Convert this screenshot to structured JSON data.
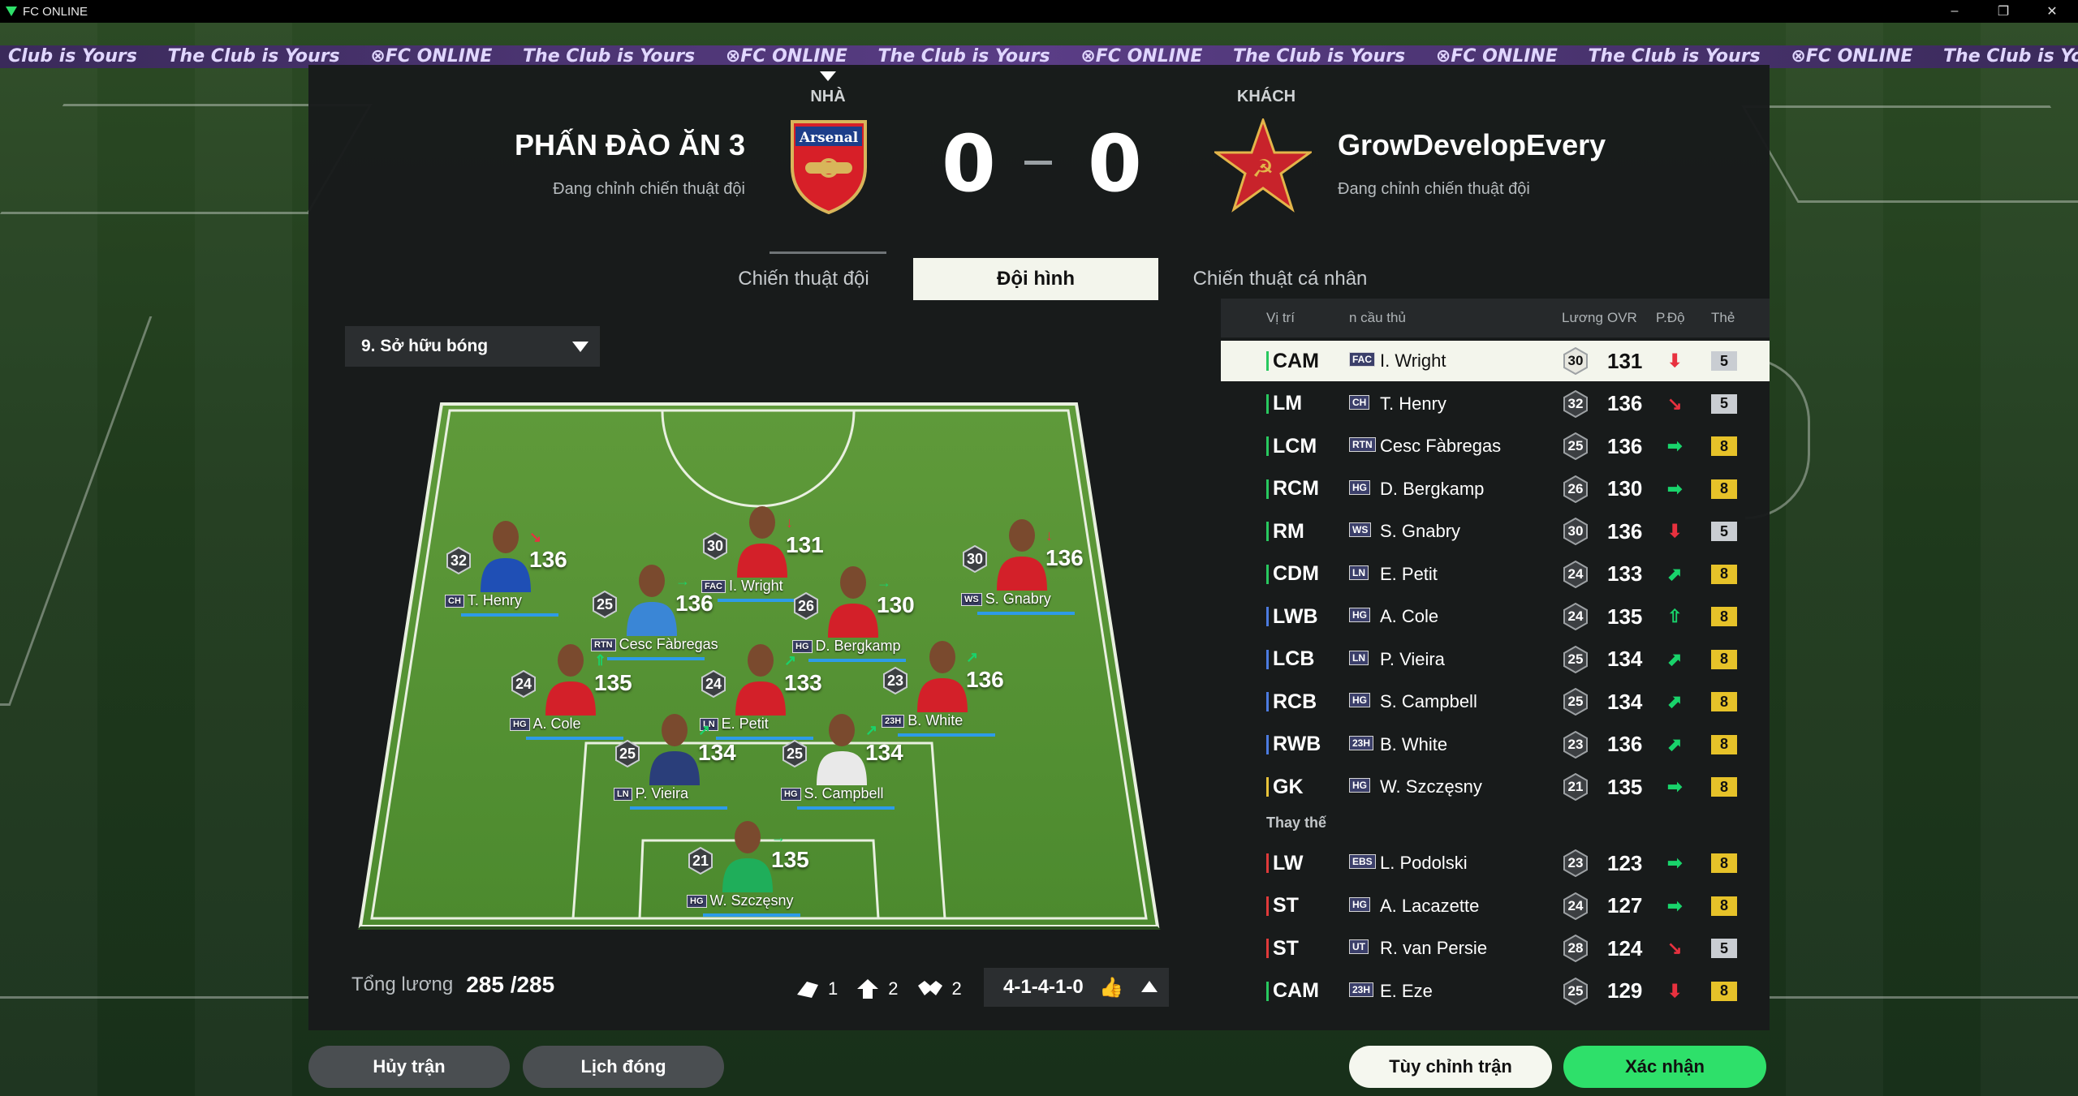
{
  "window": {
    "title": "FC ONLINE",
    "minimize": "–",
    "restore": "❐",
    "close": "✕"
  },
  "banner": {
    "items": [
      "The Club is Yours",
      "⊗FC ONLINE",
      "The Club is Yours",
      "⊗FC ONLINE",
      "The Club is Yours",
      "⊗FC ONLINE",
      "The Club is Yours",
      "⊗FC ONLINE",
      "The Club is Yours",
      "⊗FC ONLINE",
      "The Club is Yours"
    ]
  },
  "match": {
    "home_label": "NHÀ",
    "away_label": "KHÁCH",
    "home_name": "PHẤN ĐÀO ĂN 3",
    "home_status": "Đang chỉnh chiến thuật đội",
    "home_crest_text": "Arsenal",
    "away_name": "GrowDevelopEvery",
    "away_status": "Đang chỉnh chiến thuật đội",
    "home_score": "0",
    "away_score": "0"
  },
  "tabs": [
    {
      "label": "Chiến thuật đội"
    },
    {
      "label": "Đội hình"
    },
    {
      "label": "Chiến thuật cá nhân"
    }
  ],
  "tactic_dropdown": {
    "value": "9. Sở hữu bóng"
  },
  "colors": {
    "accent_green": "#2ee06a",
    "trend_up": "#19d36b",
    "trend_down": "#e8313f",
    "card_gold": "#e6c229",
    "card_silver": "#c9cdd2",
    "pos_bar_green": "#28c85f",
    "pos_bar_red": "#e03a3a",
    "pos_bar_yellow": "#e8c33a"
  },
  "pitch_players": [
    {
      "name": "T. Henry",
      "badge": "CH",
      "pay": "32",
      "ovr": "136",
      "trend": "↘",
      "trend_color": "#e8313f",
      "shirt": "#1f4fb5"
    },
    {
      "name": "I. Wright",
      "badge": "FAC",
      "pay": "30",
      "ovr": "131",
      "trend": "↓",
      "trend_color": "#e8313f",
      "shirt": "#d32029"
    },
    {
      "name": "S. Gnabry",
      "badge": "WS",
      "pay": "30",
      "ovr": "136",
      "trend": "↓",
      "trend_color": "#e8313f",
      "shirt": "#d32029"
    },
    {
      "name": "Cesc Fàbregas",
      "badge": "RTN",
      "pay": "25",
      "ovr": "136",
      "trend": "→",
      "trend_color": "#19d36b",
      "shirt": "#3a86d6"
    },
    {
      "name": "D. Bergkamp",
      "badge": "HG",
      "pay": "26",
      "ovr": "130",
      "trend": "→",
      "trend_color": "#19d36b",
      "shirt": "#d32029"
    },
    {
      "name": "E. Petit",
      "badge": "LN",
      "pay": "24",
      "ovr": "133",
      "trend": "↗",
      "trend_color": "#19d36b",
      "shirt": "#d32029"
    },
    {
      "name": "A. Cole",
      "badge": "HG",
      "pay": "24",
      "ovr": "135",
      "trend": "⇑",
      "trend_color": "#19d36b",
      "shirt": "#d32029"
    },
    {
      "name": "B. White",
      "badge": "23H",
      "pay": "23",
      "ovr": "136",
      "trend": "↗",
      "trend_color": "#19d36b",
      "shirt": "#d32029"
    },
    {
      "name": "P. Vieira",
      "badge": "LN",
      "pay": "25",
      "ovr": "134",
      "trend": "↗",
      "trend_color": "#19d36b",
      "shirt": "#2a3e7a"
    },
    {
      "name": "S. Campbell",
      "badge": "HG",
      "pay": "25",
      "ovr": "134",
      "trend": "↗",
      "trend_color": "#19d36b",
      "shirt": "#e9e9e9"
    },
    {
      "name": "W. Szczęsny",
      "badge": "HG",
      "pay": "21",
      "ovr": "135",
      "trend": "→",
      "trend_color": "#19d36b",
      "shirt": "#1fae5a"
    }
  ],
  "salary": {
    "label": "Tổng lương",
    "value": "285 /285"
  },
  "captains": {
    "c1": "1",
    "c2": "2",
    "c3": "2"
  },
  "formation": {
    "value": "4-1-4-1-0"
  },
  "table": {
    "headers": {
      "pos": "Vị trí",
      "name": "n cầu thủ",
      "pay": "Lương",
      "ovr": "OVR",
      "trend": "P.Độ",
      "card": "Thẻ"
    },
    "starters": [
      {
        "pos": "CAM",
        "badge": "FAC",
        "name": "I. Wright",
        "pay": "30",
        "ovr": "131",
        "trend": "⬇",
        "trend_color": "#e8313f",
        "card": "5",
        "card_color": "#c9cdd2",
        "bar": "#28c85f"
      },
      {
        "pos": "LM",
        "badge": "CH",
        "name": "T. Henry",
        "pay": "32",
        "ovr": "136",
        "trend": "↘",
        "trend_color": "#e8313f",
        "card": "5",
        "card_color": "#c9cdd2",
        "bar": "#28c85f"
      },
      {
        "pos": "LCM",
        "badge": "RTN",
        "name": "Cesc Fàbregas",
        "pay": "25",
        "ovr": "136",
        "trend": "➡",
        "trend_color": "#19d36b",
        "card": "8",
        "card_color": "#e6c229",
        "bar": "#28c85f"
      },
      {
        "pos": "RCM",
        "badge": "HG",
        "name": "D. Bergkamp",
        "pay": "26",
        "ovr": "130",
        "trend": "➡",
        "trend_color": "#19d36b",
        "card": "8",
        "card_color": "#e6c229",
        "bar": "#28c85f"
      },
      {
        "pos": "RM",
        "badge": "WS",
        "name": "S. Gnabry",
        "pay": "30",
        "ovr": "136",
        "trend": "⬇",
        "trend_color": "#e8313f",
        "card": "5",
        "card_color": "#c9cdd2",
        "bar": "#28c85f"
      },
      {
        "pos": "CDM",
        "badge": "LN",
        "name": "E. Petit",
        "pay": "24",
        "ovr": "133",
        "trend": "⬈",
        "trend_color": "#19d36b",
        "card": "8",
        "card_color": "#e6c229",
        "bar": "#28c85f"
      },
      {
        "pos": "LWB",
        "badge": "HG",
        "name": "A. Cole",
        "pay": "24",
        "ovr": "135",
        "trend": "⇧",
        "trend_color": "#19d36b",
        "card": "8",
        "card_color": "#e6c229",
        "bar": "#4b7be0"
      },
      {
        "pos": "LCB",
        "badge": "LN",
        "name": "P. Vieira",
        "pay": "25",
        "ovr": "134",
        "trend": "⬈",
        "trend_color": "#19d36b",
        "card": "8",
        "card_color": "#e6c229",
        "bar": "#4b7be0"
      },
      {
        "pos": "RCB",
        "badge": "HG",
        "name": "S. Campbell",
        "pay": "25",
        "ovr": "134",
        "trend": "⬈",
        "trend_color": "#19d36b",
        "card": "8",
        "card_color": "#e6c229",
        "bar": "#4b7be0"
      },
      {
        "pos": "RWB",
        "badge": "23H",
        "name": "B. White",
        "pay": "23",
        "ovr": "136",
        "trend": "⬈",
        "trend_color": "#19d36b",
        "card": "8",
        "card_color": "#e6c229",
        "bar": "#4b7be0"
      },
      {
        "pos": "GK",
        "badge": "HG",
        "name": "W. Szczęsny",
        "pay": "21",
        "ovr": "135",
        "trend": "➡",
        "trend_color": "#19d36b",
        "card": "8",
        "card_color": "#e6c229",
        "bar": "#e8c33a"
      }
    ],
    "subs_label": "Thay thế",
    "subs": [
      {
        "pos": "LW",
        "badge": "EBS",
        "name": "L. Podolski",
        "pay": "23",
        "ovr": "123",
        "trend": "➡",
        "trend_color": "#19d36b",
        "card": "8",
        "card_color": "#e6c229",
        "bar": "#e03a3a"
      },
      {
        "pos": "ST",
        "badge": "HG",
        "name": "A. Lacazette",
        "pay": "24",
        "ovr": "127",
        "trend": "➡",
        "trend_color": "#19d36b",
        "card": "8",
        "card_color": "#e6c229",
        "bar": "#e03a3a"
      },
      {
        "pos": "ST",
        "badge": "UT",
        "name": "R. van Persie",
        "pay": "28",
        "ovr": "124",
        "trend": "↘",
        "trend_color": "#e8313f",
        "card": "5",
        "card_color": "#c9cdd2",
        "bar": "#e03a3a"
      },
      {
        "pos": "CAM",
        "badge": "23H",
        "name": "E. Eze",
        "pay": "25",
        "ovr": "129",
        "trend": "⬇",
        "trend_color": "#e8313f",
        "card": "8",
        "card_color": "#e6c229",
        "bar": "#28c85f"
      }
    ]
  },
  "buttons": {
    "cancel": "Hủy trận",
    "schedule": "Lịch đóng",
    "customize": "Tùy chỉnh trận",
    "confirm": "Xác nhận"
  }
}
